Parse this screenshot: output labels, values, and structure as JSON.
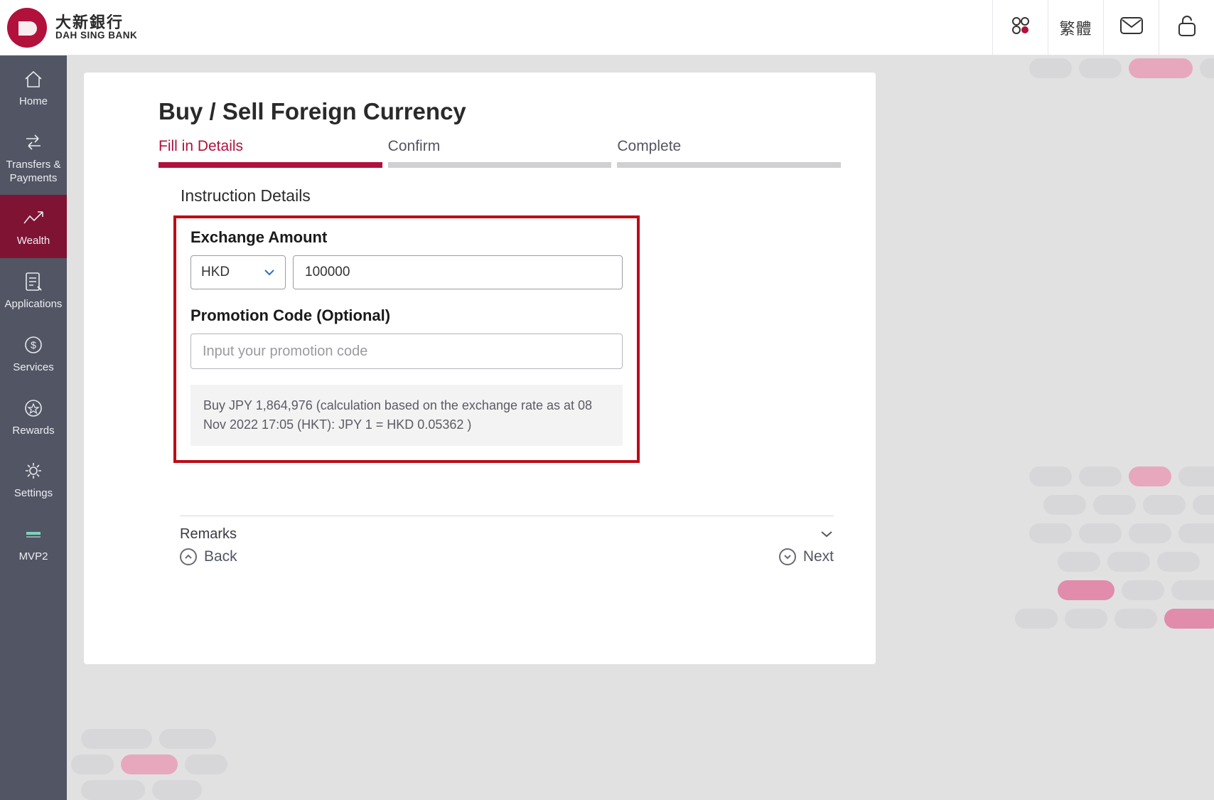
{
  "brand": {
    "zh": "大新銀行",
    "en": "DAH SING BANK"
  },
  "header": {
    "lang_label": "繁體"
  },
  "sidebar": {
    "items": [
      {
        "key": "home",
        "label": "Home"
      },
      {
        "key": "transfers",
        "label": "Transfers & Payments"
      },
      {
        "key": "wealth",
        "label": "Wealth"
      },
      {
        "key": "applications",
        "label": "Applications"
      },
      {
        "key": "services",
        "label": "Services"
      },
      {
        "key": "rewards",
        "label": "Rewards"
      },
      {
        "key": "settings",
        "label": "Settings"
      },
      {
        "key": "mvp2",
        "label": "MVP2"
      }
    ]
  },
  "page": {
    "title": "Buy / Sell Foreign Currency",
    "steps": [
      {
        "label": "Fill in Details",
        "active": true
      },
      {
        "label": "Confirm",
        "active": false
      },
      {
        "label": "Complete",
        "active": false
      }
    ],
    "section_title": "Instruction Details",
    "exchange": {
      "label": "Exchange Amount",
      "currency_selected": "HKD",
      "amount_value": "100000"
    },
    "promo": {
      "label": "Promotion Code (Optional)",
      "placeholder": "Input your promotion code",
      "value": ""
    },
    "rate_banner": "Buy JPY 1,864,976 (calculation based on the exchange rate as at 08 Nov 2022 17:05 (HKT): JPY 1 = HKD 0.05362 )",
    "remarks_label": "Remarks",
    "back_label": "Back",
    "next_label": "Next"
  }
}
